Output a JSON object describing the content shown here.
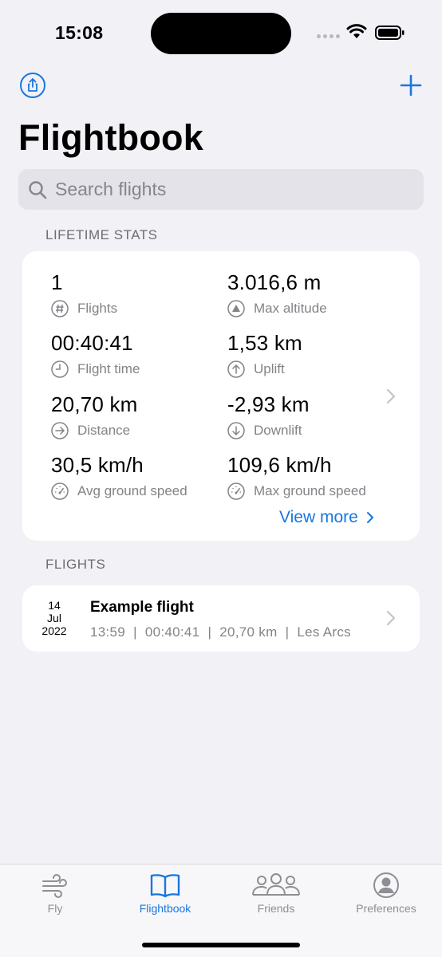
{
  "status_bar": {
    "time": "15:08"
  },
  "header": {
    "title": "Flightbook"
  },
  "search": {
    "placeholder": "Search flights",
    "value": ""
  },
  "lifetime_stats": {
    "header": "LIFETIME STATS",
    "stats": [
      {
        "value": "1",
        "label": "Flights",
        "icon": "number-sign-icon"
      },
      {
        "value": "3.016,6 m",
        "label": "Max altitude",
        "icon": "triangle-up-icon"
      },
      {
        "value": "00:40:41",
        "label": "Flight time",
        "icon": "clock-icon"
      },
      {
        "value": "1,53 km",
        "label": "Uplift",
        "icon": "arrow-up-circle-icon"
      },
      {
        "value": "20,70 km",
        "label": "Distance",
        "icon": "arrow-right-circle-icon"
      },
      {
        "value": "-2,93 km",
        "label": "Downlift",
        "icon": "arrow-down-circle-icon"
      },
      {
        "value": "30,5 km/h",
        "label": "Avg ground speed",
        "icon": "gauge-icon"
      },
      {
        "value": "109,6 km/h",
        "label": "Max ground speed",
        "icon": "gauge-icon"
      }
    ],
    "view_more": "View more"
  },
  "flights": {
    "header": "FLIGHTS",
    "items": [
      {
        "day": "14",
        "month": "Jul",
        "year": "2022",
        "title": "Example flight",
        "meta": "13:59  |  00:40:41  |  20,70 km  |  Les Arcs"
      }
    ]
  },
  "tab_bar": {
    "tabs": [
      {
        "label": "Fly",
        "icon": "wind-icon",
        "active": false
      },
      {
        "label": "Flightbook",
        "icon": "book-icon",
        "active": true
      },
      {
        "label": "Friends",
        "icon": "people-icon",
        "active": false
      },
      {
        "label": "Preferences",
        "icon": "person-circle-icon",
        "active": false
      }
    ]
  },
  "colors": {
    "accent": "#1877e0",
    "background": "#f2f1f6",
    "secondary_text": "#838388"
  }
}
